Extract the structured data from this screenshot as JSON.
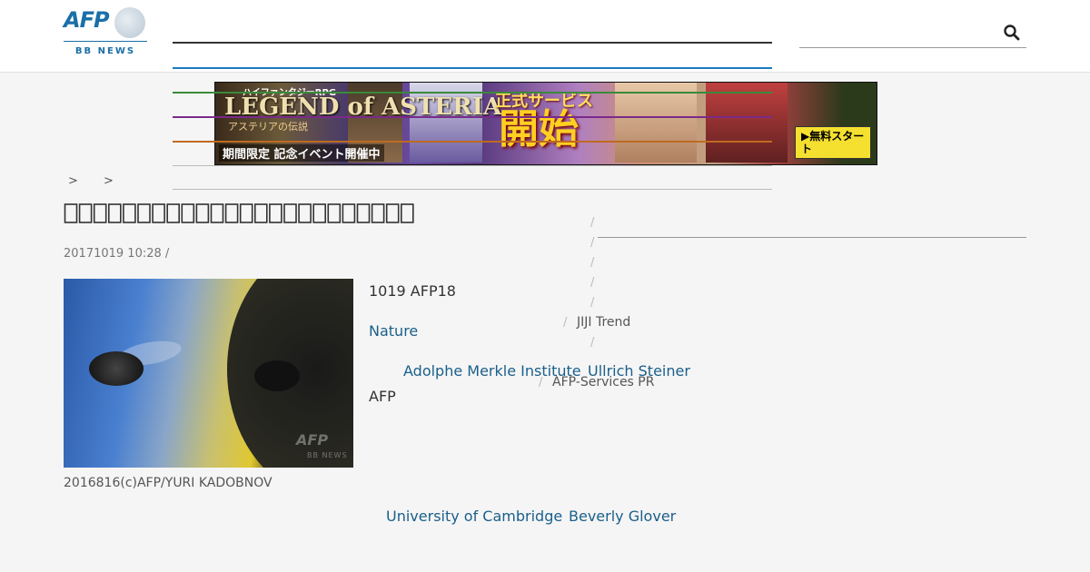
{
  "header": {
    "logo": {
      "brand": "AFP",
      "sub": "BB NEWS"
    },
    "search": {
      "placeholder": ""
    }
  },
  "ad": {
    "top_text": "ハイファンタジーRPG",
    "title": "LEGEND of ASTERIA",
    "subtitle": "アステリアの伝説",
    "banner": "期間限定 記念イベント開催中",
    "service": "正式サービス",
    "start": "開始",
    "button": "▶無料スタート"
  },
  "breadcrumb": [
    ">",
    ">"
  ],
  "article": {
    "headline": "　　　　　　　　　　　　　　　　　　　　　　　　",
    "meta": "20171019 10:28  /",
    "photo_caption": "2016816(c)AFP/YURI KADOBNOV",
    "photo_watermark": "AFP",
    "photo_watermark_sub": "BB NEWS",
    "p1": "1019 AFP18",
    "p2": "Nature",
    "p3_link1": "Adolphe Merkle Institute",
    "p3_link2": "Ullrich Steiner",
    "p4": "AFP",
    "p5_link1": "University of Cambridge",
    "p5_link2": "Beverly Glover"
  },
  "sidebar": {
    "item1": "JIJI Trend",
    "item2": "AFP-Services PR",
    "slash": "/"
  },
  "colors": {
    "brand": "#1a6fa8",
    "link": "#1a5f8a",
    "line_green": "#3a8a3a",
    "line_purple": "#7a2a8a",
    "line_orange": "#c06a20"
  }
}
